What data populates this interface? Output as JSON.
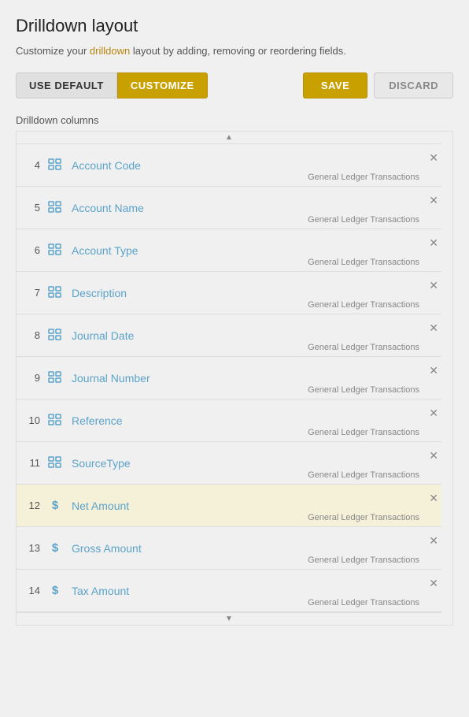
{
  "page": {
    "title": "Drilldown layout",
    "subtitle_plain": "Customize your drilldown layout by adding, removing or reordering fields.",
    "subtitle_link": "drilldown"
  },
  "toolbar": {
    "use_default_label": "USE DEFAULT",
    "customize_label": "CUSTOMIZE",
    "save_label": "SAVE",
    "discard_label": "DISCARD"
  },
  "section": {
    "label": "Drilldown columns"
  },
  "rows": [
    {
      "num": 4,
      "type": "grid",
      "name": "Account Code",
      "source": "General Ledger Transactions",
      "highlighted": false
    },
    {
      "num": 5,
      "type": "grid",
      "name": "Account Name",
      "source": "General Ledger Transactions",
      "highlighted": false
    },
    {
      "num": 6,
      "type": "grid",
      "name": "Account Type",
      "source": "General Ledger Transactions",
      "highlighted": false
    },
    {
      "num": 7,
      "type": "grid",
      "name": "Description",
      "source": "General Ledger Transactions",
      "highlighted": false
    },
    {
      "num": 8,
      "type": "grid",
      "name": "Journal Date",
      "source": "General Ledger Transactions",
      "highlighted": false
    },
    {
      "num": 9,
      "type": "grid",
      "name": "Journal Number",
      "source": "General Ledger Transactions",
      "highlighted": false
    },
    {
      "num": 10,
      "type": "grid",
      "name": "Reference",
      "source": "General Ledger Transactions",
      "highlighted": false
    },
    {
      "num": 11,
      "type": "grid",
      "name": "SourceType",
      "source": "General Ledger Transactions",
      "highlighted": false
    },
    {
      "num": 12,
      "type": "dollar",
      "name": "Net Amount",
      "source": "General Ledger Transactions",
      "highlighted": true
    },
    {
      "num": 13,
      "type": "dollar",
      "name": "Gross Amount",
      "source": "General Ledger Transactions",
      "highlighted": false
    },
    {
      "num": 14,
      "type": "dollar",
      "name": "Tax Amount",
      "source": "General Ledger Transactions",
      "highlighted": false
    }
  ]
}
